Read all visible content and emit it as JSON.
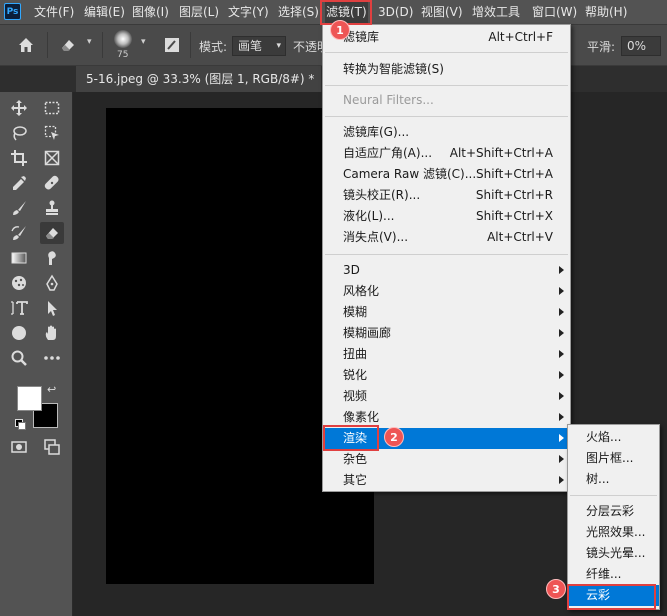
{
  "app": {
    "logo": "Ps"
  },
  "menubar": [
    {
      "label": "文件(F)"
    },
    {
      "label": "编辑(E)"
    },
    {
      "label": "图像(I)"
    },
    {
      "label": "图层(L)"
    },
    {
      "label": "文字(Y)"
    },
    {
      "label": "选择(S)"
    },
    {
      "label": "滤镜(T)"
    },
    {
      "label": "3D(D)"
    },
    {
      "label": "视图(V)"
    },
    {
      "label": "增效工具"
    },
    {
      "label": "窗口(W)"
    },
    {
      "label": "帮助(H)"
    }
  ],
  "options": {
    "brush_size": "75",
    "mode_label": "模式:",
    "mode_value": "画笔",
    "opacity_label": "不透明",
    "smooth_label": "平滑:",
    "smooth_value": "0%"
  },
  "document_tab": {
    "title": "5-16.jpeg @ 33.3% (图层 1, RGB/8#) *"
  },
  "steps": {
    "one": "1",
    "two": "2",
    "three": "3"
  },
  "filter_menu": {
    "items": [
      {
        "label": "滤镜库",
        "shortcut": "Alt+Ctrl+F"
      },
      {
        "label": "转换为智能滤镜(S)",
        "shortcut": ""
      },
      {
        "label": "Neural Filters...",
        "shortcut": ""
      },
      {
        "label": "滤镜库(G)...",
        "shortcut": ""
      },
      {
        "label": "自适应广角(A)...",
        "shortcut": "Alt+Shift+Ctrl+A"
      },
      {
        "label": "Camera Raw 滤镜(C)...",
        "shortcut": "Shift+Ctrl+A"
      },
      {
        "label": "镜头校正(R)...",
        "shortcut": "Shift+Ctrl+R"
      },
      {
        "label": "液化(L)...",
        "shortcut": "Shift+Ctrl+X"
      },
      {
        "label": "消失点(V)...",
        "shortcut": "Alt+Ctrl+V"
      },
      {
        "label": "3D",
        "shortcut": ""
      },
      {
        "label": "风格化",
        "shortcut": ""
      },
      {
        "label": "模糊",
        "shortcut": ""
      },
      {
        "label": "模糊画廊",
        "shortcut": ""
      },
      {
        "label": "扭曲",
        "shortcut": ""
      },
      {
        "label": "锐化",
        "shortcut": ""
      },
      {
        "label": "视频",
        "shortcut": ""
      },
      {
        "label": "像素化",
        "shortcut": ""
      },
      {
        "label": "渲染",
        "shortcut": ""
      },
      {
        "label": "杂色",
        "shortcut": ""
      },
      {
        "label": "其它",
        "shortcut": ""
      }
    ]
  },
  "render_menu": {
    "items": [
      {
        "label": "火焰..."
      },
      {
        "label": "图片框..."
      },
      {
        "label": "树..."
      },
      {
        "label": "分层云彩"
      },
      {
        "label": "光照效果..."
      },
      {
        "label": "镜头光晕..."
      },
      {
        "label": "纤维..."
      },
      {
        "label": "云彩"
      }
    ]
  },
  "colors": {
    "menu_highlight": "#0078d7",
    "annotation": "#e04040",
    "foreground_swatch": "#ffffff",
    "background_swatch": "#000000"
  }
}
